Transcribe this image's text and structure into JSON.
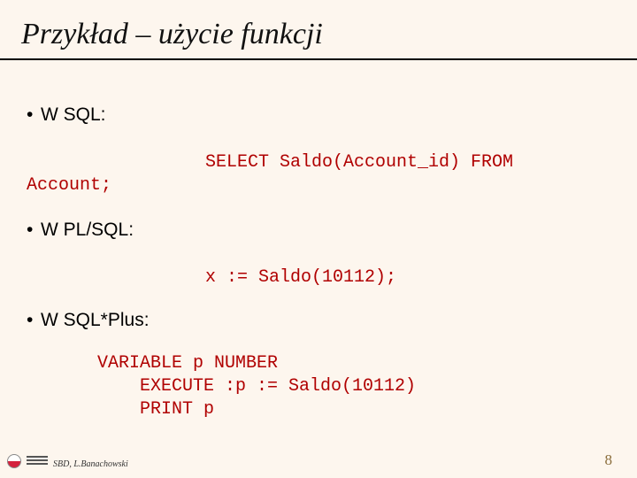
{
  "title": "Przykład – użycie funkcji",
  "bullets": {
    "b1": "W SQL:",
    "b2": "W PL/SQL:",
    "b3": "W SQL*Plus:"
  },
  "code": {
    "sql_line1": "SELECT Saldo(Account_id) FROM",
    "sql_line2": "Account;",
    "plsql": "x := Saldo(10112);",
    "sqlplus": "VARIABLE p NUMBER\n    EXECUTE :p := Saldo(10112)\n    PRINT p"
  },
  "footer": {
    "credit": "SBD, L.Banachowski",
    "page": "8"
  }
}
